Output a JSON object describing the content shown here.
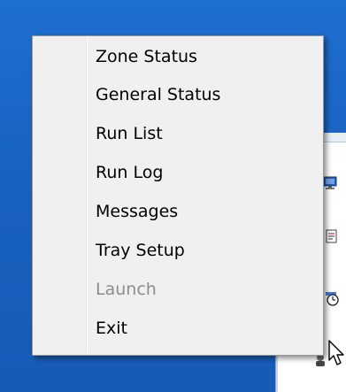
{
  "menu": {
    "items": [
      {
        "label": "Zone Status",
        "enabled": true
      },
      {
        "label": "General Status",
        "enabled": true
      },
      {
        "label": "Run List",
        "enabled": true
      },
      {
        "label": "Run Log",
        "enabled": true
      },
      {
        "label": "Messages",
        "enabled": true
      },
      {
        "label": "Tray Setup",
        "enabled": true
      },
      {
        "label": "Launch",
        "enabled": false
      },
      {
        "label": "Exit",
        "enabled": true
      }
    ]
  },
  "colors": {
    "desktop": "#1a63c2",
    "menu_background": "#f0f0f0",
    "menu_border": "#979797",
    "disabled_text": "#8d8d8d"
  },
  "icons": [
    "monitor-icon",
    "document-icon",
    "clock-icon",
    "person-icon",
    "pointer-cursor-icon"
  ]
}
